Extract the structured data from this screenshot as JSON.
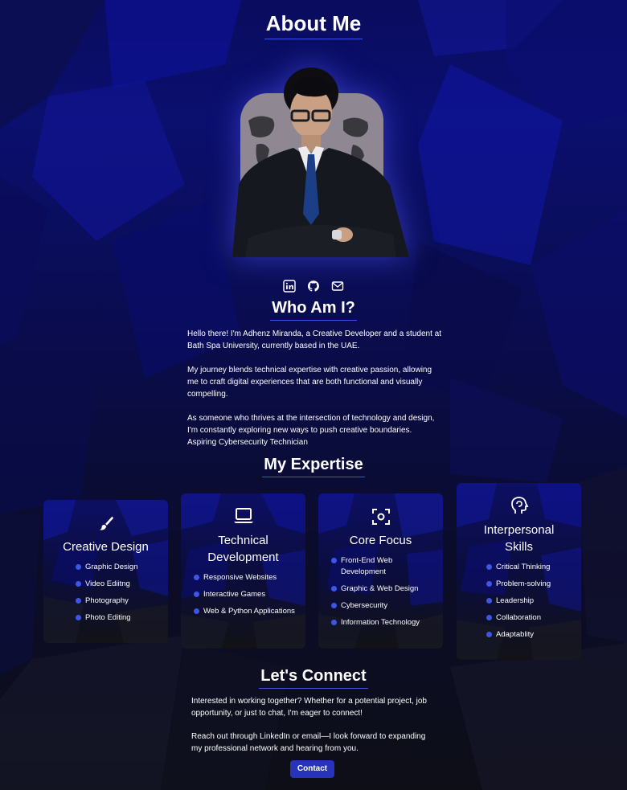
{
  "header": {
    "title": "About Me"
  },
  "who": {
    "title": "Who Am I?",
    "paragraphs": [
      "Hello there! I'm Adhenz Miranda, a Creative Developer and a student at Bath Spa University, currently based in the UAE.",
      "My journey blends technical expertise with creative passion, allowing me to craft digital experiences that are both functional and visually compelling.",
      "As someone who thrives at the intersection of technology and design, I'm constantly exploring new ways to push creative boundaries. Aspiring Cybersecurity Technician"
    ]
  },
  "socials": [
    {
      "icon": "linkedin-icon"
    },
    {
      "icon": "github-icon"
    },
    {
      "icon": "mail-icon"
    }
  ],
  "expertise": {
    "title": "My Expertise",
    "cards": [
      {
        "icon": "paintbrush-icon",
        "title": "Creative Design",
        "items": [
          "Graphic Design",
          "Video Ediitng",
          "Photography",
          "Photo Editing"
        ]
      },
      {
        "icon": "laptop-icon",
        "title": "Technical Development",
        "items": [
          "Responsive Websites",
          "Interactive Games",
          "Web & Python Applications"
        ]
      },
      {
        "icon": "focus-icon",
        "title": "Core Focus",
        "items": [
          "Front-End Web Development",
          "Graphic & Web Design",
          "Cybersecurity",
          "Information Technology"
        ]
      },
      {
        "icon": "head-brain-icon",
        "title": "Interpersonal Skills",
        "items": [
          "Critical Thinking",
          "Problem-solving",
          "Leadership",
          "Collaboration",
          "Adaptablity"
        ]
      }
    ]
  },
  "connect": {
    "title": "Let's Connect",
    "paragraphs": [
      "Interested in working together? Whether for a potential project, job opportunity, or just to chat, I'm eager to connect!",
      "Reach out through LinkedIn or email—I look forward to expanding my professional network and hearing from you."
    ],
    "button_label": "Contact"
  },
  "colors": {
    "accent": "#3e56e6",
    "button": "#2733b8",
    "background_top": "#0b0f6e",
    "background_bottom": "#0d0e16"
  }
}
